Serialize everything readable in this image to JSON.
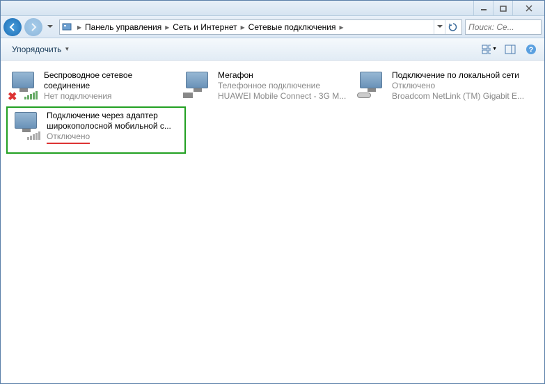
{
  "window": {
    "minimize": "_",
    "maximize": "❐",
    "close": "✕"
  },
  "breadcrumbs": {
    "root_icon": "control-panel-icon",
    "items": [
      "Панель управления",
      "Сеть и Интернет",
      "Сетевые подключения",
      ""
    ]
  },
  "search": {
    "placeholder": "Поиск: Се..."
  },
  "toolbar": {
    "organize": "Упорядочить"
  },
  "connections": [
    {
      "title": "Беспроводное сетевое соединение",
      "status": "Нет подключения",
      "device": "",
      "icon_type": "wireless-x",
      "highlighted": false
    },
    {
      "title": "Мегафон",
      "status": "Телефонное подключение",
      "device": "HUAWEI Mobile Connect - 3G M...",
      "icon_type": "dialup",
      "highlighted": false
    },
    {
      "title": "Подключение по локальной сети",
      "status": "Отключено",
      "device": "Broadcom NetLink (TM) Gigabit E...",
      "icon_type": "ethernet",
      "highlighted": false
    },
    {
      "title": "Подключение через адаптер широкополосной мобильной с...",
      "status": "Отключено",
      "device": "",
      "icon_type": "mobile",
      "highlighted": true,
      "status_underlined": true
    }
  ]
}
